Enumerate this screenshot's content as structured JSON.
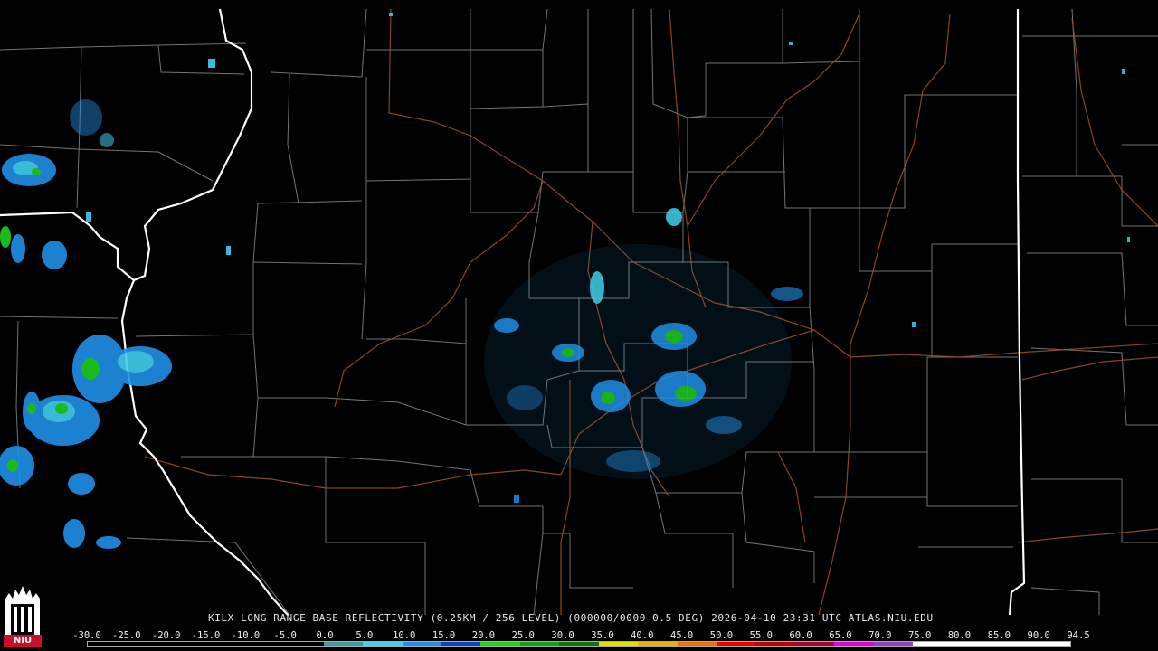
{
  "product": {
    "caption": "KILX LONG RANGE BASE REFLECTIVITY (0.25KM / 256 LEVEL) (000000/0000 0.5 DEG) 2026-04-10 23:31 UTC  ATLAS.NIU.EDU"
  },
  "scale": {
    "labels": [
      "-30.0",
      "-25.0",
      "-20.0",
      "-15.0",
      "-10.0",
      "-5.0",
      "0.0",
      "5.0",
      "10.0",
      "15.0",
      "20.0",
      "25.0",
      "30.0",
      "35.0",
      "40.0",
      "45.0",
      "50.0",
      "55.0",
      "60.0",
      "65.0",
      "70.0",
      "75.0",
      "80.0",
      "85.0",
      "90.0",
      "94.5"
    ],
    "colors": [
      "#000000",
      "#000000",
      "#000000",
      "#000000",
      "#000000",
      "#000000",
      "#3a9e9e",
      "#40d0f0",
      "#2090e8",
      "#1040c8",
      "#20d020",
      "#10a010",
      "#087808",
      "#e0e000",
      "#e8b000",
      "#f07000",
      "#f00000",
      "#c00000",
      "#b00030",
      "#e000e0",
      "#9040c0",
      "#ffffff",
      "#ffffff",
      "#ffffff",
      "#ffffff"
    ]
  },
  "logo": {
    "text": "NIU"
  },
  "colors": {
    "state_border": "#ffffff",
    "county_border": "#8a8a8a",
    "highway": "#a0522d",
    "background": "#000000"
  }
}
